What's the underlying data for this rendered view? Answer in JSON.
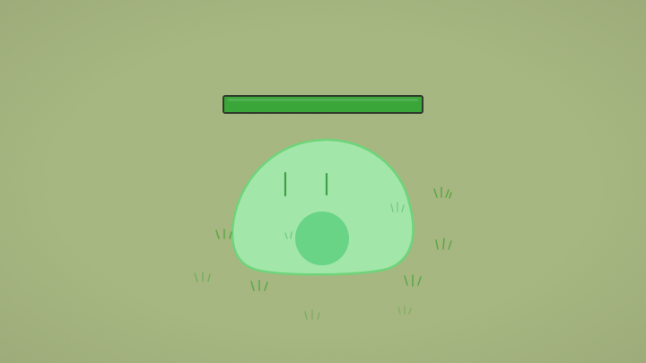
{
  "colors": {
    "background": "#a9b983",
    "health_fill": "#3aa63a",
    "health_border": "#2f3a2a",
    "slime_body": "#a3e6a9",
    "slime_outline": "#6fd47a",
    "slime_mouth": "#69d486",
    "slime_eyes": "#3f9f4a",
    "grass": "#5fa84a"
  },
  "enemy": {
    "type": "slime",
    "health_fraction": 1.0,
    "expression": "surprised"
  },
  "icons": {
    "health": "health-bar",
    "enemy": "slime-icon",
    "decor": "grass-tuft-icon"
  }
}
